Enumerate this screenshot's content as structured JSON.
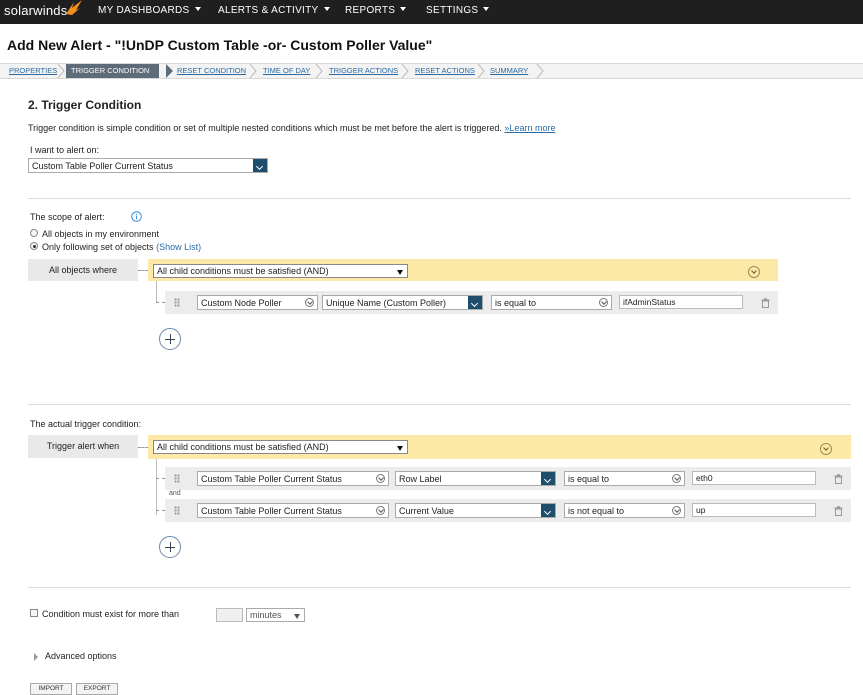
{
  "nav": {
    "logo": "solarwinds",
    "items": [
      {
        "label": "MY DASHBOARDS"
      },
      {
        "label": "ALERTS & ACTIVITY"
      },
      {
        "label": "REPORTS"
      },
      {
        "label": "SETTINGS"
      }
    ]
  },
  "page_title": "Add New Alert - \"!UnDP Custom Table -or- Custom Poller Value\"",
  "steps": [
    "PROPERTIES",
    "TRIGGER CONDITION",
    "RESET CONDITION",
    "TIME OF DAY",
    "TRIGGER ACTIONS",
    "RESET ACTIONS",
    "SUMMARY"
  ],
  "section_title": "2. Trigger Condition",
  "description": "Trigger condition is simple condition or set of multiple nested conditions which must be met before the alert is triggered.",
  "learn_more": "»Learn more",
  "alert_on_label": "I want to alert on:",
  "alert_on_value": "Custom Table Poller Current Status",
  "scope": {
    "label": "The scope of alert:",
    "option_all": "All objects in my environment",
    "option_following": "Only following set of objects",
    "show_list": "(Show List)",
    "where_label": "All objects where",
    "group_value": "All child conditions must be satisfied (AND)",
    "cond": {
      "field1": "Custom Node Poller",
      "field2": "Unique Name (Custom Poller)",
      "operator": "is equal to",
      "value": "ifAdminStatus"
    }
  },
  "trigger": {
    "label": "The actual trigger condition:",
    "when_label": "Trigger alert when",
    "group_value": "All child conditions must be satisfied (AND)",
    "and_label": "and",
    "conds": [
      {
        "field1": "Custom Table Poller Current Status",
        "field2": "Row Label",
        "operator": "is equal to",
        "value": "eth0"
      },
      {
        "field1": "Custom Table Poller Current Status",
        "field2": "Current Value",
        "operator": "is not equal to",
        "value": "up"
      }
    ]
  },
  "condition_exist": {
    "label": "Condition must exist for more than",
    "value": "",
    "unit": "minutes"
  },
  "advanced": "Advanced options",
  "buttons": {
    "import": "IMPORT",
    "export": "EXPORT"
  },
  "colors": {
    "nav_bg": "#1f1f1f",
    "active_step": "#5e6b78",
    "group_bg": "#fde9a6",
    "dropdown_btn": "#1f4d6e",
    "link": "#2a6aa5"
  }
}
